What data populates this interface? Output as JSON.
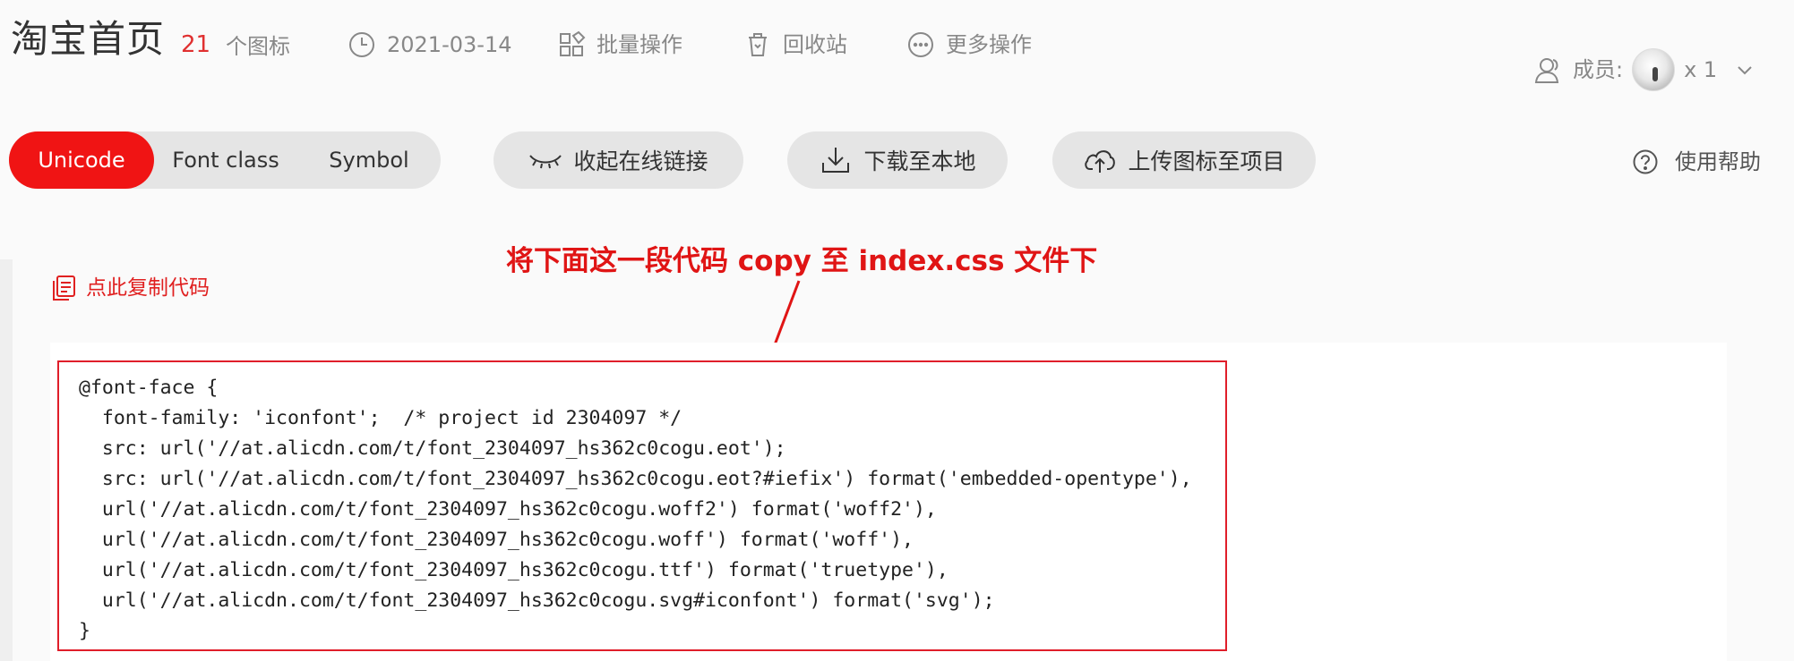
{
  "header": {
    "title": "淘宝首页",
    "icon_count": "21",
    "icon_count_unit": "个图标",
    "date": "2021-03-14",
    "batch_label": "批量操作",
    "trash_label": "回收站",
    "more_label": "更多操作",
    "members_label": "成员:",
    "members_count": "x 1"
  },
  "tabs": [
    {
      "label": "Unicode",
      "active": true
    },
    {
      "label": "Font class",
      "active": false
    },
    {
      "label": "Symbol",
      "active": false
    }
  ],
  "actions": {
    "collapse_label": "收起在线链接",
    "download_label": "下载至本地",
    "upload_label": "上传图标至项目",
    "help_label": "使用帮助"
  },
  "code_panel": {
    "copy_label": "点此复制代码",
    "annotation": "将下面这一段代码 copy 至 index.css 文件下",
    "lines": [
      "@font-face {",
      "  font-family: 'iconfont';  /* project id 2304097 */",
      "  src: url('//at.alicdn.com/t/font_2304097_hs362c0cogu.eot');",
      "  src: url('//at.alicdn.com/t/font_2304097_hs362c0cogu.eot?#iefix') format('embedded-opentype'),",
      "  url('//at.alicdn.com/t/font_2304097_hs362c0cogu.woff2') format('woff2'),",
      "  url('//at.alicdn.com/t/font_2304097_hs362c0cogu.woff') format('woff'),",
      "  url('//at.alicdn.com/t/font_2304097_hs362c0cogu.ttf') format('truetype'),",
      "  url('//at.alicdn.com/t/font_2304097_hs362c0cogu.svg#iconfont') format('svg');",
      "}"
    ]
  },
  "colors": {
    "accent": "#f01414",
    "annotation": "#e01515",
    "box_border": "#e01e2a"
  },
  "icons": {
    "date": "clock-icon",
    "batch": "grid-icon",
    "trash": "trash-icon",
    "more": "ellipsis-circle-icon",
    "members": "person-icon",
    "collapse": "eye-closed-icon",
    "download": "download-icon",
    "upload": "cloud-upload-icon",
    "help": "question-circle-icon",
    "copy": "copy-document-icon"
  }
}
